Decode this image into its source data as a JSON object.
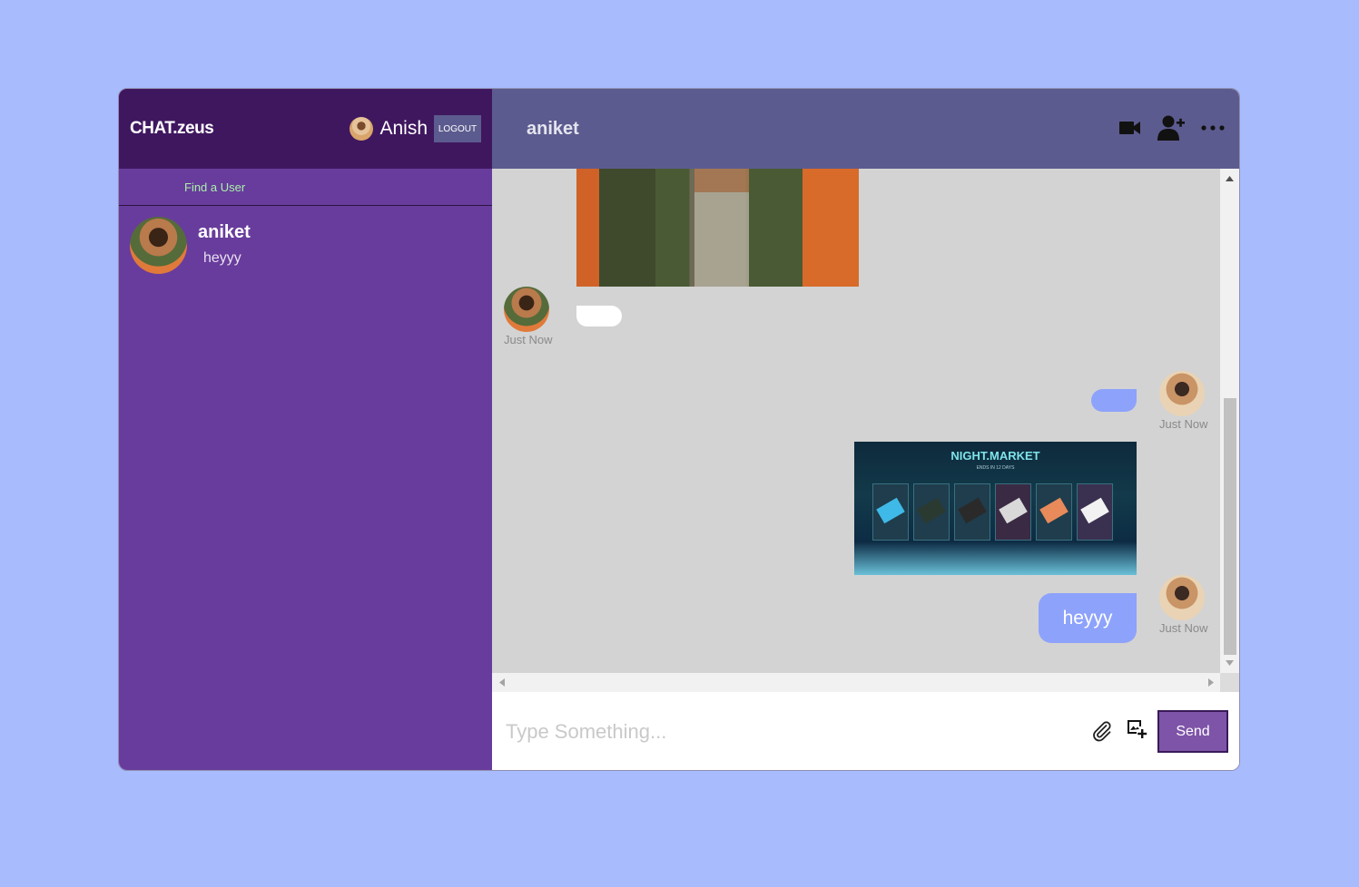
{
  "app": {
    "logo": "CHAT.zeus",
    "current_user": "Anish",
    "logout_label": "LOGOUT"
  },
  "sidebar": {
    "search_placeholder": "Find a User",
    "chats": [
      {
        "name": "aniket",
        "last_message": "heyyy"
      }
    ]
  },
  "chat": {
    "title": "aniket",
    "header_icons": [
      "video-camera-icon",
      "add-user-icon",
      "more-icon"
    ],
    "messages": [
      {
        "from": "aniket",
        "type": "image",
        "timestamp": ""
      },
      {
        "from": "aniket",
        "type": "text",
        "text": "",
        "timestamp": "Just Now"
      },
      {
        "from": "Anish",
        "type": "text",
        "text": "",
        "timestamp": "Just Now"
      },
      {
        "from": "Anish",
        "type": "image",
        "image_title": "NIGHT.MARKET",
        "image_subtitle": "ENDS IN 12 DAYS"
      },
      {
        "from": "Anish",
        "type": "text",
        "text": "heyyy",
        "timestamp": "Just Now"
      }
    ]
  },
  "composer": {
    "placeholder": "Type Something...",
    "send_label": "Send"
  },
  "colors": {
    "background": "#a7bbfd",
    "sidebar": "#683c9c",
    "sidebar_header": "#3f175f",
    "chat_header": "#5c5b8f",
    "own_bubble": "#8da2fb",
    "send_button": "#7e54a8"
  }
}
